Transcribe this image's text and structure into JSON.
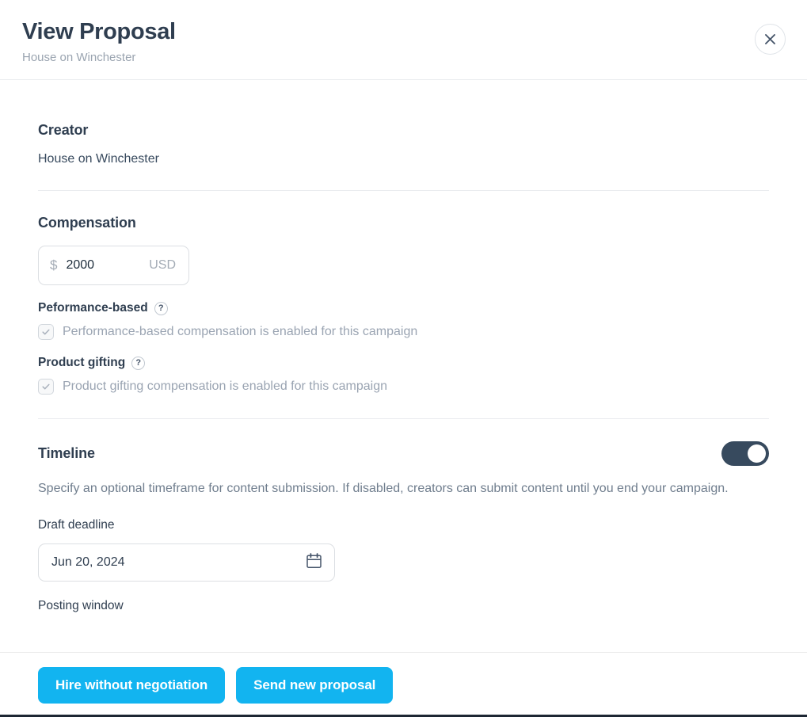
{
  "header": {
    "title": "View Proposal",
    "subtitle": "House on Winchester",
    "close_label": "×",
    "close_icon": "close-icon"
  },
  "creator": {
    "section_title": "Creator",
    "name": "House on Winchester"
  },
  "compensation": {
    "section_title": "Compensation",
    "currency_prefix": "$",
    "amount": "2000",
    "currency_code": "USD",
    "performance": {
      "label": "Peformance-based",
      "help_icon": "?",
      "checkbox_label": "Performance-based compensation is enabled for this campaign",
      "checked": true
    },
    "gifting": {
      "label": "Product gifting",
      "help_icon": "?",
      "checkbox_label": "Product gifting compensation is enabled for this campaign",
      "checked": true
    }
  },
  "timeline": {
    "section_title": "Timeline",
    "toggle_on": true,
    "description": "Specify an optional timeframe for content submission. If disabled, creators can submit content until you end your campaign.",
    "draft_deadline_label": "Draft deadline",
    "draft_deadline_value": "Jun 20, 2024",
    "calendar_icon": "calendar-icon",
    "posting_window_label": "Posting window"
  },
  "footer": {
    "primary_button": "Hire without negotiation",
    "secondary_button": "Send new proposal"
  },
  "colors": {
    "accent_blue": "#12b4f0",
    "navy": "#2f3e50",
    "toggle_on": "#374a5e",
    "muted_text": "#9aa4b2",
    "border": "#dcdfe3"
  }
}
